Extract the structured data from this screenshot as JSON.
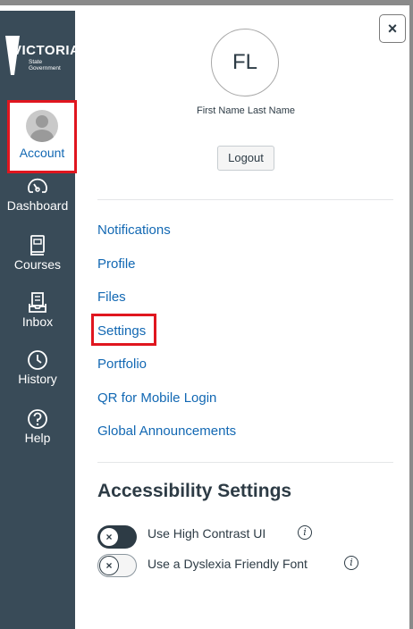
{
  "logo": {
    "wordmark": "VICTORIA",
    "subtitle": "State Government"
  },
  "nav": {
    "account": "Account",
    "dashboard": "Dashboard",
    "courses": "Courses",
    "inbox": "Inbox",
    "history": "History",
    "help": "Help"
  },
  "tray": {
    "close_icon": "×",
    "avatar_initials": "FL",
    "user_name": "First Name Last Name",
    "logout_label": "Logout",
    "links": [
      "Notifications",
      "Profile",
      "Files",
      "Settings",
      "Portfolio",
      "QR for Mobile Login",
      "Global Announcements"
    ],
    "accessibility_title": "Accessibility Settings",
    "options": [
      {
        "label": "Use High Contrast UI",
        "state": "on"
      },
      {
        "label": "Use a Dyslexia Friendly Font",
        "state": "off"
      }
    ],
    "toggle_knob": "×",
    "info_glyph": "i"
  },
  "colors": {
    "rail": "#394b58",
    "link": "#1268b3",
    "highlight": "#e0161f",
    "text": "#2d3b45"
  }
}
